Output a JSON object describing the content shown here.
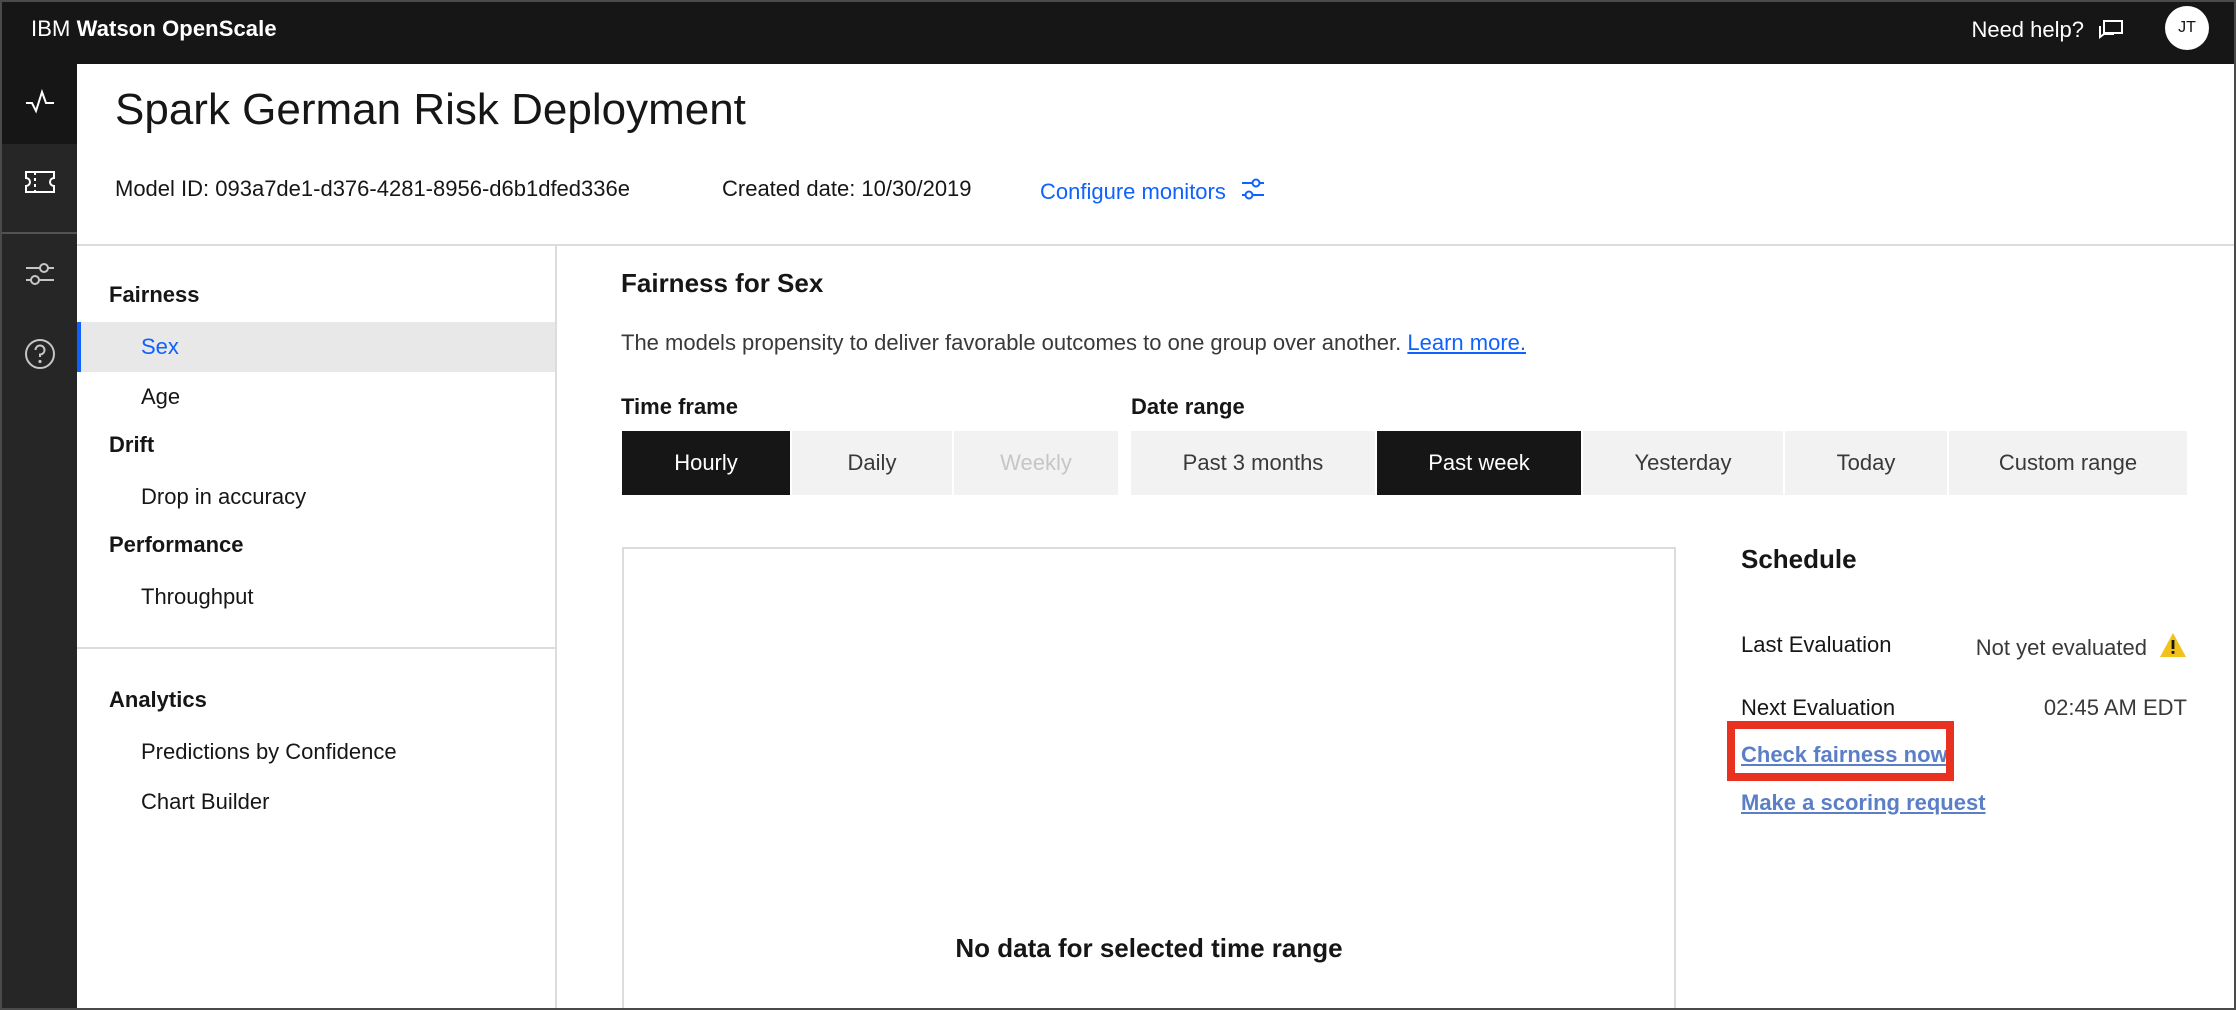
{
  "header": {
    "brand_prefix": "IBM",
    "brand_name": "Watson OpenScale",
    "help_label": "Need help?",
    "avatar_initials": "JT"
  },
  "rail": {
    "items": [
      {
        "icon": "activity-icon"
      },
      {
        "icon": "ticket-icon"
      },
      {
        "icon": "settings-sliders-icon"
      },
      {
        "icon": "help-circle-icon"
      }
    ]
  },
  "page": {
    "title": "Spark German Risk Deployment",
    "model_id": "Model ID: 093a7de1-d376-4281-8956-d6b1dfed336e",
    "created_date": "Created date: 10/30/2019",
    "configure_label": "Configure monitors"
  },
  "nav": {
    "fairness_heading": "Fairness",
    "sex": "Sex",
    "age": "Age",
    "drift_heading": "Drift",
    "drop_accuracy": "Drop in accuracy",
    "performance_heading": "Performance",
    "throughput": "Throughput",
    "analytics_heading": "Analytics",
    "predictions_confidence": "Predictions by Confidence",
    "chart_builder": "Chart Builder"
  },
  "main": {
    "section_title": "Fairness for Sex",
    "description": "The models propensity to deliver favorable outcomes to one group over another.",
    "learn_more": "Learn more.",
    "time_frame_label": "Time frame",
    "date_range_label": "Date range",
    "time_frame_options": [
      "Hourly",
      "Daily",
      "Weekly"
    ],
    "time_frame_selected": "Hourly",
    "date_range_options": [
      "Past 3 months",
      "Past week",
      "Yesterday",
      "Today",
      "Custom range"
    ],
    "date_range_selected": "Past week",
    "no_data": "No data for selected time range"
  },
  "schedule": {
    "title": "Schedule",
    "last_eval_label": "Last Evaluation",
    "last_eval_value": "Not yet evaluated",
    "next_eval_label": "Next Evaluation",
    "next_eval_value": "02:45 AM EDT",
    "check_now": "Check fairness now",
    "scoring_request": "Make a scoring request"
  },
  "colors": {
    "header_bg": "#161616",
    "accent_blue": "#0f62fe",
    "highlight_red": "#e8321f",
    "warning_yellow": "#f1c21b"
  }
}
